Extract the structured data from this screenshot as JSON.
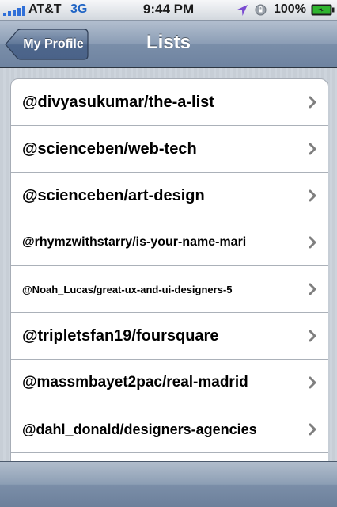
{
  "status_bar": {
    "carrier": "AT&T",
    "network": "3G",
    "time": "9:44 PM",
    "battery_percent": "100%",
    "icons": [
      "signal-bars-icon",
      "location-arrow-icon",
      "rotation-lock-icon",
      "battery-charging-icon"
    ]
  },
  "nav": {
    "back_label": "My Profile",
    "title": "Lists"
  },
  "lists": [
    {
      "label": "@divyasukumar/the-a-list"
    },
    {
      "label": "@scienceben/web-tech"
    },
    {
      "label": "@scienceben/art-design"
    },
    {
      "label": "@rhymzwithstarry/is-your-name-mari"
    },
    {
      "label": "@Noah_Lucas/great-ux-and-ui-designers-5"
    },
    {
      "label": "@tripletsfan19/foursquare"
    },
    {
      "label": "@massmbayet2pac/real-madrid"
    },
    {
      "label": "@dahl_donald/designers-agencies"
    },
    {
      "label": ""
    }
  ],
  "colors": {
    "nav_bar": "#7a8ea9",
    "background": "#c7ced6",
    "row_background": "#ffffff",
    "chevron": "#7f7f7f",
    "battery": "#2fb52f",
    "location_arrow": "#7a4bd1",
    "network": "#1e63c4"
  }
}
